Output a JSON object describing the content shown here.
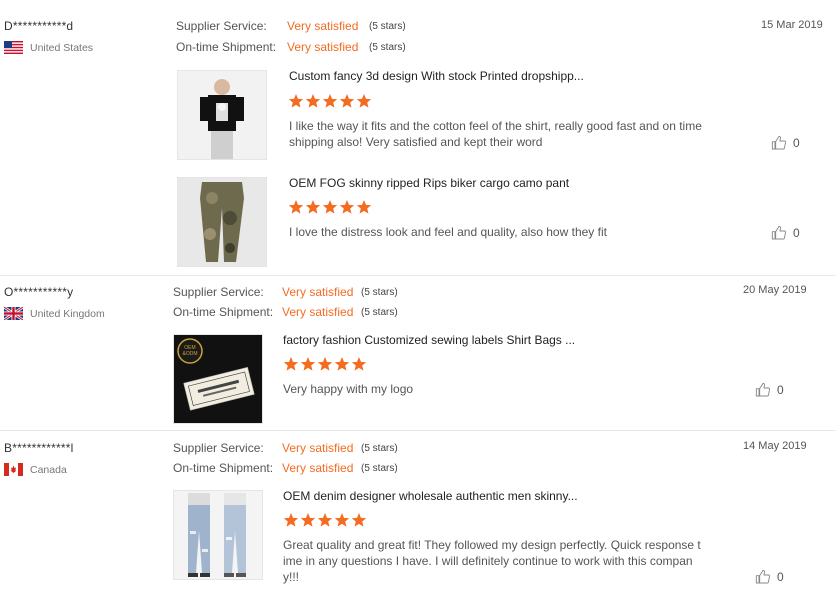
{
  "reviews": [
    {
      "buyer": "D***********d",
      "country": "United States",
      "supplier_label": "Supplier Service:",
      "supplier_value": "Very satisfied",
      "supplier_stars": "(5 stars)",
      "shipment_label": "On-time Shipment:",
      "shipment_value": "Very satisfied",
      "shipment_stars": "(5 stars)",
      "date": "15 Mar 2019",
      "products": [
        {
          "title": "Custom fancy 3d design With stock Printed dropshipp...",
          "rating": 5,
          "comment": "I like the way it fits and the cotton feel of the shirt, really good fast and on time shipping also! Very satisfied and kept their word",
          "likes": "0"
        },
        {
          "title": "OEM FOG skinny ripped Rips biker cargo camo pant",
          "rating": 5,
          "comment": "I love the distress look and feel and quality, also how they fit",
          "likes": "0"
        }
      ]
    },
    {
      "buyer": "O***********y",
      "country": "United Kingdom",
      "supplier_label": "Supplier Service:",
      "supplier_value": "Very satisfied",
      "supplier_stars": "(5 stars)",
      "shipment_label": "On-time Shipment:",
      "shipment_value": "Very satisfied",
      "shipment_stars": "(5 stars)",
      "date": "20 May 2019",
      "products": [
        {
          "title": "factory fashion Customized sewing labels Shirt Bags ...",
          "rating": 5,
          "comment": "Very happy with my logo",
          "likes": "0",
          "label_badge": "OEM & ODM"
        }
      ]
    },
    {
      "buyer": "B************l",
      "country": "Canada",
      "supplier_label": "Supplier Service:",
      "supplier_value": "Very satisfied",
      "supplier_stars": "(5 stars)",
      "shipment_label": "On-time Shipment:",
      "shipment_value": "Very satisfied",
      "shipment_stars": "(5 stars)",
      "date": "14 May 2019",
      "products": [
        {
          "title": "OEM denim designer wholesale authentic men skinny...",
          "rating": 5,
          "comment_lines": [
            "Great quality and great fit! They followed my design perfectly. Quick response t",
            "ime in any questions I have. I will definitely continue to work with this compan",
            "y!!!"
          ],
          "likes": "0"
        }
      ]
    }
  ],
  "icons": {
    "like": "thumbs-up-icon",
    "star": "star-icon"
  },
  "colors": {
    "accent": "#f36c21"
  }
}
